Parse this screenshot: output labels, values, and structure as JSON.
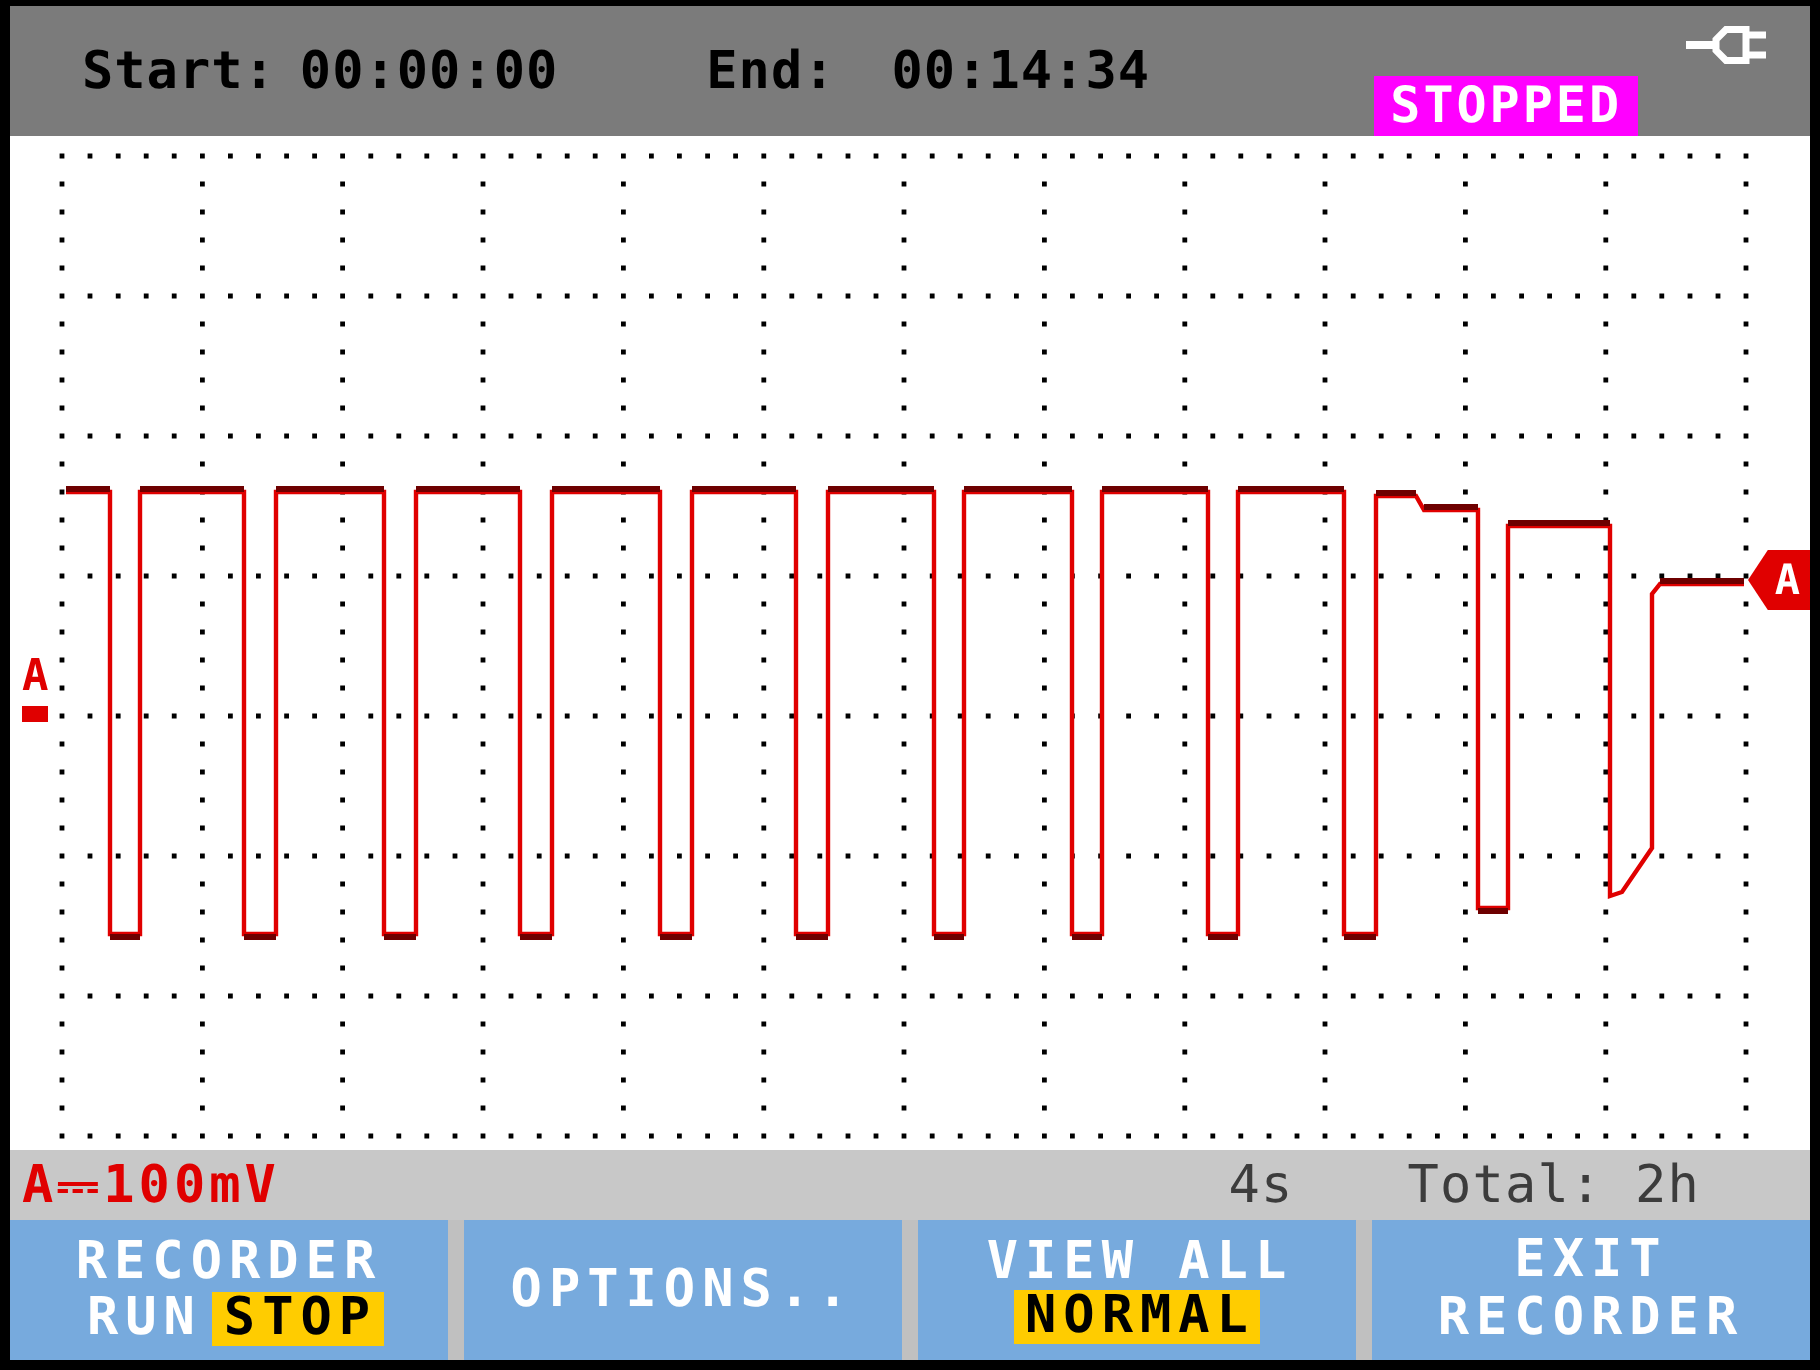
{
  "header": {
    "start_label": "Start:",
    "start_time": "00:00:00",
    "end_label": "End:",
    "end_time": "00:14:34",
    "status_badge": "STOPPED"
  },
  "plot": {
    "ground_marker": "A",
    "trace_marker": "A"
  },
  "status_bar": {
    "channel_range": "A⎓100mV",
    "time_per_division": "4s",
    "total_time": "Total: 2h"
  },
  "softkeys": [
    {
      "kind": "inline-toggle",
      "title": "RECORDER",
      "options": [
        {
          "label": "RUN",
          "selected": false
        },
        {
          "label": "STOP",
          "selected": true
        }
      ]
    },
    {
      "kind": "label",
      "lines": [
        "OPTIONS.."
      ]
    },
    {
      "kind": "stacked-toggle",
      "options": [
        {
          "label": "VIEW ALL",
          "selected": false
        },
        {
          "label": "NORMAL",
          "selected": true
        }
      ]
    },
    {
      "kind": "label",
      "lines": [
        "EXIT",
        "RECORDER"
      ]
    }
  ]
}
